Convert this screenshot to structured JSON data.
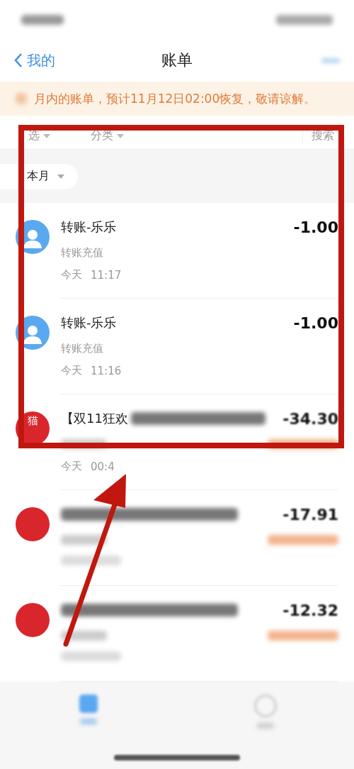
{
  "nav": {
    "back": "我的",
    "title": "账单"
  },
  "notice": {
    "text": "月内的账单，预计11月12日02:00恢复，敬请谅解。"
  },
  "filters": [
    {
      "label": "选"
    },
    {
      "label": "分类"
    }
  ],
  "search": {
    "label": "搜索"
  },
  "period": {
    "label": "本月"
  },
  "transactions": [
    {
      "kind": "transfer",
      "title": "转账-乐乐",
      "subtitle": "转账充值",
      "day": "今天",
      "time": "11:17",
      "amount": "-1.00"
    },
    {
      "kind": "transfer",
      "title": "转账-乐乐",
      "subtitle": "转账充值",
      "day": "今天",
      "time": "11:16",
      "amount": "-1.00"
    },
    {
      "kind": "shop",
      "badge": "猫",
      "title": "【双11狂欢",
      "day": "今天",
      "time": "00:4",
      "amount": "-34.30"
    },
    {
      "kind": "shop",
      "amount": "-17.91"
    },
    {
      "kind": "shop",
      "amount": "-12.32"
    }
  ],
  "bottom_tabs": [
    {
      "selected": true
    },
    {
      "selected": false
    }
  ]
}
